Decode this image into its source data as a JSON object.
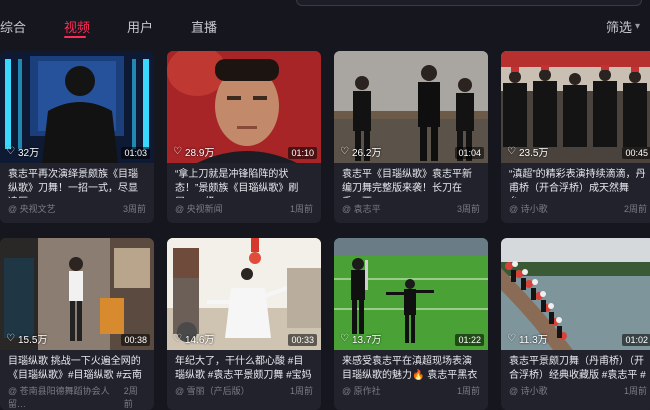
{
  "tabs": [
    {
      "label": "综合"
    },
    {
      "label": "视频"
    },
    {
      "label": "用户"
    },
    {
      "label": "直播"
    }
  ],
  "filter": {
    "label": "筛选",
    "icon": "chevron-down-icon"
  },
  "videos": [
    {
      "likes": "32万",
      "duration": "01:03",
      "desc": "袁志平再次演绎景颇族《目瑙纵歌》刀舞！一招一式，尽显凌厉…",
      "author": "@ 央视文艺",
      "time": "3周前"
    },
    {
      "likes": "28.9万",
      "duration": "01:10",
      "desc": "“拿上刀就是冲锋陷阵的状态！”景颇族《目瑙纵歌》刷屏，一级…",
      "author": "@ 央视新闻",
      "time": "1周前"
    },
    {
      "likes": "26.2万",
      "duration": "01:04",
      "desc": "袁志平《目瑙纵歌》袁志平新编刀舞完整版来袭！长刀在手，西…",
      "author": "@ 袁志平",
      "time": "3周前"
    },
    {
      "likes": "23.5万",
      "duration": "00:45",
      "desc": "“滇超”的精彩表演持续滴滴，丹甫桥（开合浮桥）成天然舞台，…",
      "author": "@ 诗小歌",
      "time": "2周前"
    },
    {
      "likes": "15.5万",
      "duration": "00:38",
      "desc": "目瑙纵歌 挑战一下火遍全网的《目瑙纵歌》#目瑙纵歌 #云南 …",
      "author": "@ 苍南县阳德舞蹈协会人留…",
      "time": "2周前"
    },
    {
      "likes": "14.6万",
      "duration": "00:33",
      "desc": "年纪大了，干什么都心酸 #目瑙纵歌 #袁志平景颇刀舞 #宝妈 #抖…",
      "author": "@ 雪丽（产后版）",
      "time": "1周前"
    },
    {
      "likes": "13.7万",
      "duration": "01:22",
      "desc": "来感受袁志平在滇超现场表演目瑙纵歌的魅力🔥 袁志平黑衣上阵…",
      "author": "@ 原作社",
      "time": "1周前"
    },
    {
      "likes": "11.3万",
      "duration": "01:02",
      "desc": "袁志平景颇刀舞（丹甫桥）（开合浮桥）经典收藏版 #袁志平 #景颇…",
      "author": "@ 诗小歌",
      "time": "1周前"
    }
  ],
  "icons": {
    "heart": "heart-icon"
  },
  "colors": {
    "accent": "#fe2c55",
    "background": "#16161e",
    "card": "#22222c"
  }
}
